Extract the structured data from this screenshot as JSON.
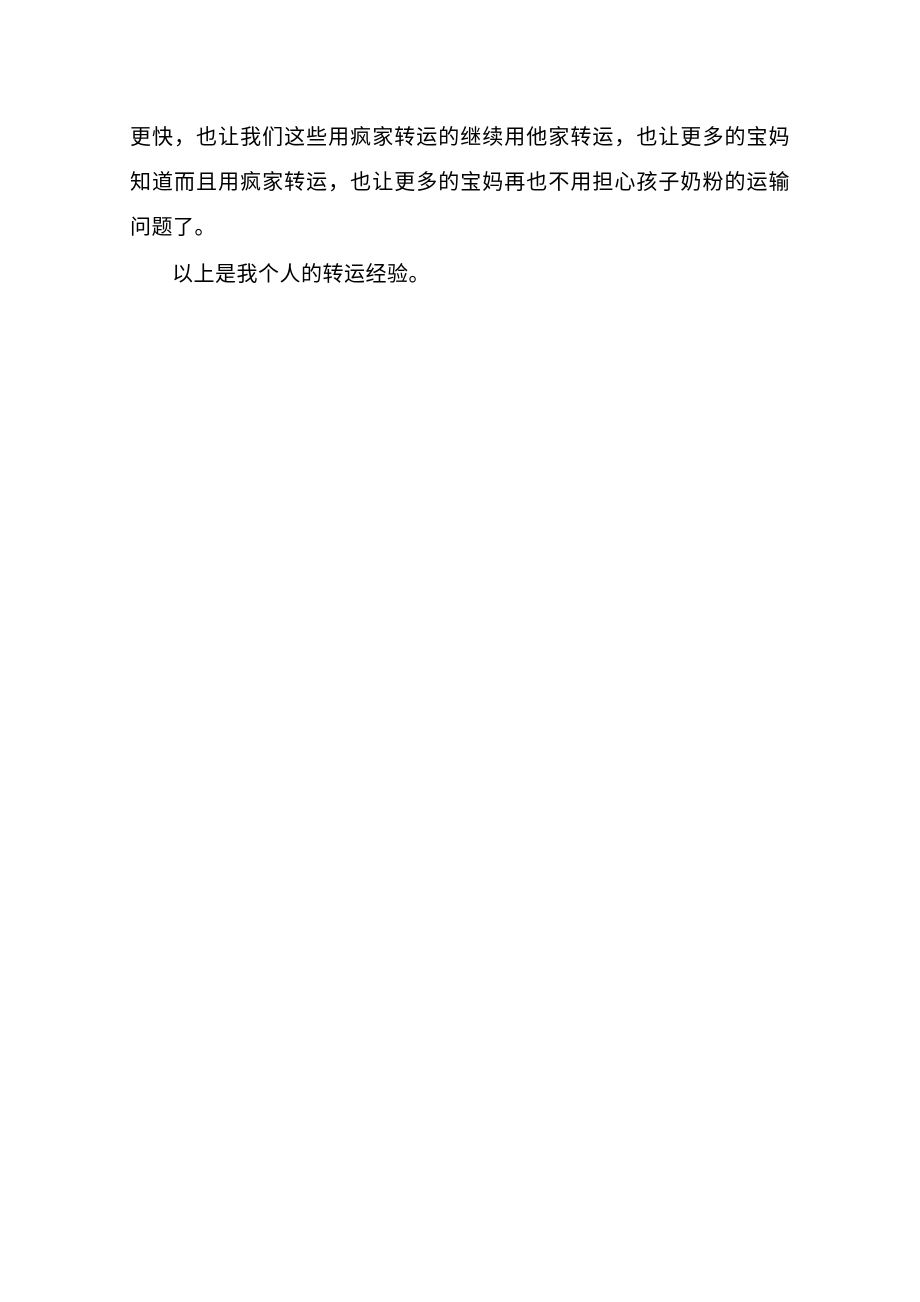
{
  "paragraphs": {
    "p1": "更快，也让我们这些用疯家转运的继续用他家转运，也让更多的宝妈知道而且用疯家转运，也让更多的宝妈再也不用担心孩子奶粉的运输问题了。",
    "p2": "以上是我个人的转运经验。"
  }
}
